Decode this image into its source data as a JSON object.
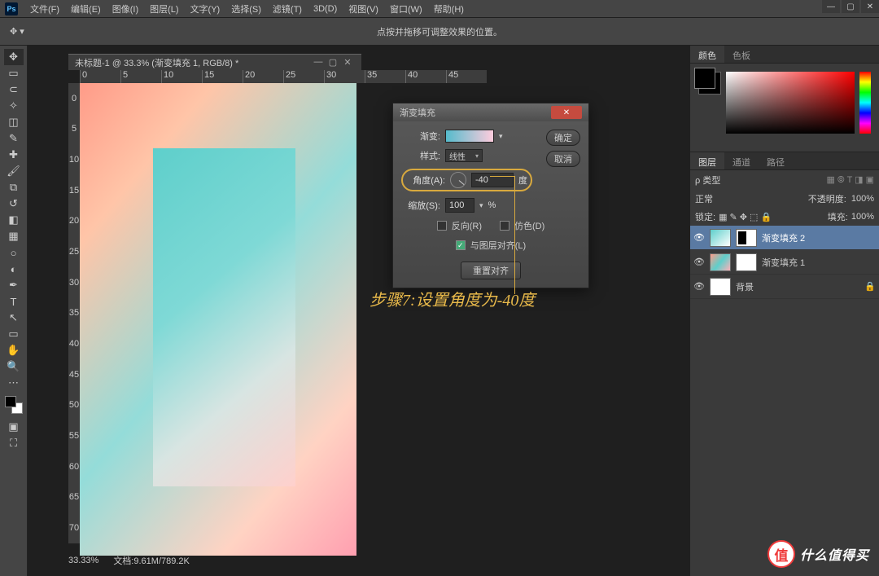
{
  "menu": {
    "items": [
      "文件(F)",
      "编辑(E)",
      "图像(I)",
      "图层(L)",
      "文字(Y)",
      "选择(S)",
      "滤镜(T)",
      "3D(D)",
      "视图(V)",
      "窗口(W)",
      "帮助(H)"
    ]
  },
  "ps_label": "Ps",
  "options_hint": "点按并拖移可调整效果的位置。",
  "doc": {
    "title": "未标题-1 @ 33.3% (渐变填充 1, RGB/8) *",
    "zoom": "33.33%",
    "filesize": "文档:9.61M/789.2K"
  },
  "ruler_h": [
    "0",
    "5",
    "10",
    "15",
    "20",
    "25",
    "30",
    "35",
    "40",
    "45"
  ],
  "ruler_v": [
    "0",
    "5",
    "10",
    "15",
    "20",
    "25",
    "30",
    "35",
    "40",
    "45",
    "50",
    "55",
    "60",
    "65",
    "70"
  ],
  "dialog": {
    "title": "渐变填充",
    "gradient_label": "渐变:",
    "style_label": "样式:",
    "style_value": "线性",
    "angle_label": "角度(A):",
    "angle_value": "-40",
    "angle_unit": "度",
    "scale_label": "缩放(S):",
    "scale_value": "100",
    "scale_unit": "%",
    "reverse": "反向(R)",
    "dither": "仿色(D)",
    "align": "与图层对齐(L)",
    "ok": "确定",
    "cancel": "取消",
    "reset": "重置对齐"
  },
  "annotation": "步骤7:设置角度为-40度",
  "panels": {
    "color_tabs": [
      "颜色",
      "色板"
    ],
    "layer_tabs": [
      "图层",
      "通道",
      "路径"
    ],
    "kind_label": "ρ 类型",
    "blend": "正常",
    "opacity_label": "不透明度:",
    "opacity_value": "100%",
    "lock_label": "锁定:",
    "fill_label": "填充:",
    "fill_value": "100%",
    "layers": [
      {
        "name": "渐变填充 2"
      },
      {
        "name": "渐变填充 1"
      },
      {
        "name": "背景"
      }
    ]
  },
  "watermark": {
    "badge": "值",
    "text": "什么值得买"
  }
}
